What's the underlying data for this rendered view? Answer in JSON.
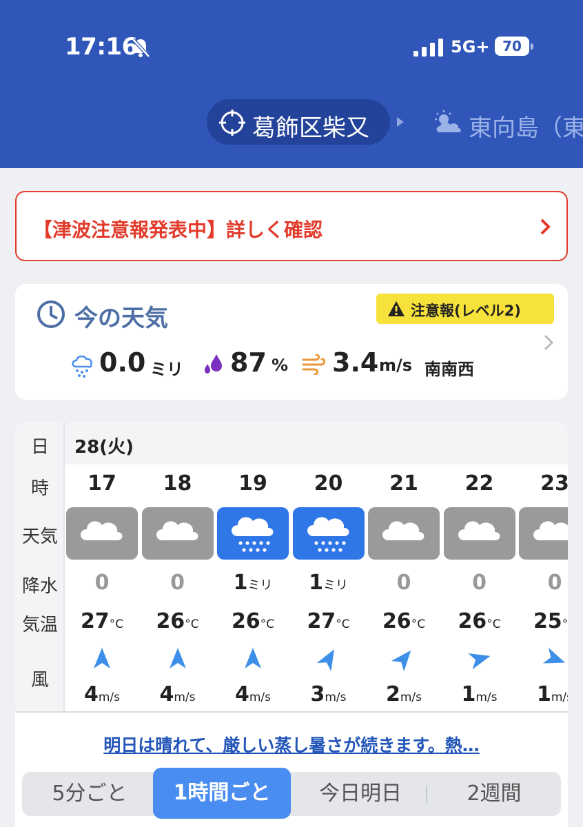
{
  "status_bar": {
    "time": "17:16",
    "network": "5G+",
    "battery": "70"
  },
  "locations": {
    "current": "葛飾区柴又",
    "next": "東向島（東"
  },
  "alert": {
    "text": "【津波注意報発表中】詳しく確認"
  },
  "now": {
    "title": "今の天気",
    "badge": "注意報(レベル2)",
    "precip_value": "0.0",
    "precip_unit": "ミリ",
    "humidity_value": "87",
    "humidity_unit": "%",
    "wind_value": "3.4",
    "wind_unit": "m/s",
    "wind_dir": "南南西"
  },
  "table": {
    "row_labels": {
      "day": "日",
      "hour": "時",
      "weather": "天気",
      "precip": "降水",
      "temp": "気温",
      "wind": "風"
    },
    "date": "28(火)",
    "precip_unit": "ミリ",
    "temp_unit": "°C",
    "wind_unit": "m/s",
    "hours": [
      {
        "hour": "17",
        "weather": "cloudy",
        "precip": "0",
        "temp": "27",
        "wind": "4",
        "wind_dir_deg": 0
      },
      {
        "hour": "18",
        "weather": "cloudy",
        "precip": "0",
        "temp": "26",
        "wind": "4",
        "wind_dir_deg": 0
      },
      {
        "hour": "19",
        "weather": "rain",
        "precip": "1",
        "temp": "26",
        "wind": "4",
        "wind_dir_deg": 0
      },
      {
        "hour": "20",
        "weather": "rain",
        "precip": "1",
        "temp": "27",
        "wind": "3",
        "wind_dir_deg": 30
      },
      {
        "hour": "21",
        "weather": "cloudy",
        "precip": "0",
        "temp": "26",
        "wind": "2",
        "wind_dir_deg": 40
      },
      {
        "hour": "22",
        "weather": "cloudy",
        "precip": "0",
        "temp": "26",
        "wind": "1",
        "wind_dir_deg": 75
      },
      {
        "hour": "23",
        "weather": "cloudy",
        "precip": "0",
        "temp": "25",
        "wind": "1",
        "wind_dir_deg": 110
      }
    ]
  },
  "summary_link": "明日は晴れて、厳しい蒸し暑さが続きます。熱…",
  "tabs": [
    {
      "label": "5分ごと",
      "active": false
    },
    {
      "label": "1時間ごと",
      "active": true
    },
    {
      "label": "今日明日",
      "active": false
    },
    {
      "label": "2週間",
      "active": false
    }
  ],
  "colors": {
    "header_bg": "#2f56b8",
    "alert_red": "#e23b2b",
    "badge_yellow": "#f6e23a",
    "rain_blue": "#2f76e6",
    "cloud_gray": "#9a9a9a",
    "active_tab": "#4a8df0"
  }
}
